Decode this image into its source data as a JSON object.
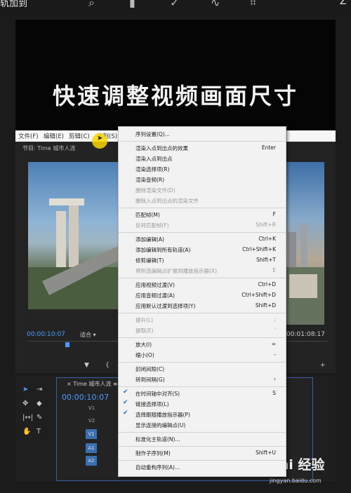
{
  "top_bar": {
    "title": "轨加到",
    "icons": [
      "search-icon",
      "trash-icon",
      "check-icon",
      "curve-icon",
      "crop-icon"
    ],
    "right": "Z"
  },
  "caption": "快速调整视频画面尺寸",
  "menubar": {
    "items": [
      "文件(F)",
      "编辑(E)",
      "剪辑(C)",
      "序列(S)"
    ]
  },
  "program_monitor": {
    "title": "节目: Time 城市人流",
    "time_left": "00:00:10:07",
    "fit": "适合",
    "time_right": "00:01:08:17",
    "controls": [
      "▼",
      "{",
      "+"
    ]
  },
  "timeline": {
    "sequence_tab": "× Time 城市人流 ≡",
    "timecode": "00:00:10:07",
    "video_tracks": [
      "V2",
      "V1"
    ],
    "audio_tracks": [
      "A1",
      "A2"
    ],
    "track_label_v": "V1"
  },
  "watermark": {
    "brand": "Bai 经验",
    "url": "jingyan.baidu.com"
  },
  "sequence_menu": {
    "items": [
      {
        "label": "序列设置(Q)...",
        "shortcut": "",
        "disabled": false,
        "checked": false
      },
      {
        "sep": true
      },
      {
        "label": "渲染入点到出点的效果",
        "shortcut": "Enter",
        "disabled": false,
        "checked": false
      },
      {
        "label": "渲染入点到出点",
        "shortcut": "",
        "disabled": false,
        "checked": false
      },
      {
        "label": "渲染选择项(R)",
        "shortcut": "",
        "disabled": false,
        "checked": false
      },
      {
        "label": "渲染音频(R)",
        "shortcut": "",
        "disabled": false,
        "checked": false
      },
      {
        "label": "删除渲染文件(D)",
        "shortcut": "",
        "disabled": true,
        "checked": false
      },
      {
        "label": "删除入点到出点的渲染文件",
        "shortcut": "",
        "disabled": true,
        "checked": false
      },
      {
        "sep": true
      },
      {
        "label": "匹配帧(M)",
        "shortcut": "F",
        "disabled": false,
        "checked": false
      },
      {
        "label": "反转匹配帧(F)",
        "shortcut": "Shift+R",
        "disabled": true,
        "checked": false
      },
      {
        "sep": true
      },
      {
        "label": "添加编辑(A)",
        "shortcut": "Ctrl+K",
        "disabled": false,
        "checked": false
      },
      {
        "label": "添加编辑到所有轨道(A)",
        "shortcut": "Ctrl+Shift+K",
        "disabled": false,
        "checked": false
      },
      {
        "label": "修剪编辑(T)",
        "shortcut": "Shift+T",
        "disabled": false,
        "checked": false
      },
      {
        "label": "将所选编辑点扩展到播放指示器(X)",
        "shortcut": "E",
        "disabled": true,
        "checked": false
      },
      {
        "sep": true
      },
      {
        "label": "应用视频过渡(V)",
        "shortcut": "Ctrl+D",
        "disabled": false,
        "checked": false
      },
      {
        "label": "应用音频过渡(A)",
        "shortcut": "Ctrl+Shift+D",
        "disabled": false,
        "checked": false
      },
      {
        "label": "应用默认过渡到选择项(Y)",
        "shortcut": "Shift+D",
        "disabled": false,
        "checked": false
      },
      {
        "sep": true
      },
      {
        "label": "提升(L)",
        "shortcut": ";",
        "disabled": true,
        "checked": false
      },
      {
        "label": "提取(E)",
        "shortcut": "'",
        "disabled": true,
        "checked": false
      },
      {
        "sep": true
      },
      {
        "label": "放大(I)",
        "shortcut": "=",
        "disabled": false,
        "checked": false
      },
      {
        "label": "缩小(O)",
        "shortcut": "-",
        "disabled": false,
        "checked": false
      },
      {
        "sep": true
      },
      {
        "label": "封闭间隙(C)",
        "shortcut": "",
        "disabled": false,
        "checked": false
      },
      {
        "label": "转到间隔(G)",
        "shortcut": "›",
        "disabled": false,
        "checked": false
      },
      {
        "sep": true
      },
      {
        "label": "在时间轴中对齐(S)",
        "shortcut": "S",
        "disabled": false,
        "checked": true
      },
      {
        "label": "链接选择项(L)",
        "shortcut": "",
        "disabled": false,
        "checked": true
      },
      {
        "label": "选择跟随播放指示器(P)",
        "shortcut": "",
        "disabled": false,
        "checked": true
      },
      {
        "label": "显示连接的编辑点(U)",
        "shortcut": "",
        "disabled": false,
        "checked": false
      },
      {
        "sep": true
      },
      {
        "label": "标准化主轨道(N)...",
        "shortcut": "",
        "disabled": false,
        "checked": false
      },
      {
        "sep": true
      },
      {
        "label": "制作子序列(M)",
        "shortcut": "Shift+U",
        "disabled": false,
        "checked": false
      },
      {
        "sep": true
      },
      {
        "label": "自动重构序列(A)...",
        "shortcut": "",
        "disabled": false,
        "checked": false
      }
    ]
  }
}
